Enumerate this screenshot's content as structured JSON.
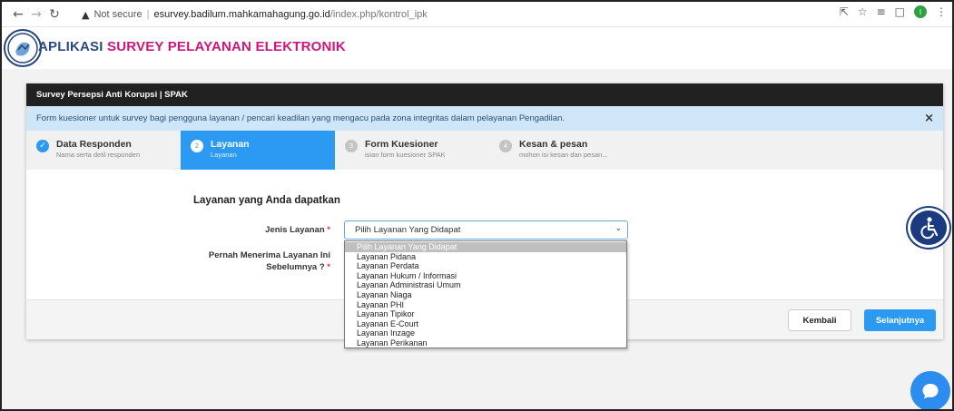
{
  "browser": {
    "security_label": "Not secure",
    "url_host": "esurvey.badilum.mahkamahagung.go.id",
    "url_path": "/index.php/kontrol_ipk",
    "profile_initial": "I"
  },
  "app": {
    "title_part1": "APLIKASI ",
    "title_part2": "SURVEY PELAYANAN ELEKTRONIK"
  },
  "card": {
    "header": "Survey Persepsi Anti Korupsi | SPAK",
    "alert": "Form kuesioner untuk survey bagi pengguna layanan / pencari keadilan yang mengacu pada zona integritas dalam pelayanan Pengadilan.",
    "alert_close": "×"
  },
  "steps": [
    {
      "number": "✓",
      "title": "Data Responden",
      "subtitle": "Nama serta detil responden",
      "state": "done"
    },
    {
      "number": "2",
      "title": "Layanan",
      "subtitle": "Layanan",
      "state": "current"
    },
    {
      "number": "3",
      "title": "Form Kuesioner",
      "subtitle": "isian form kuesioner SPAK",
      "state": "pending"
    },
    {
      "number": "4",
      "title": "Kesan & pesan",
      "subtitle": "mohon isi kesan dan pesan...",
      "state": "pending"
    }
  ],
  "form": {
    "section_title": "Layanan yang Anda dapatkan",
    "jenis_label": "Jenis Layanan",
    "pernah_label_line1": "Pernah Menerima Layanan Ini",
    "pernah_label_line2": "Sebelumnya ?",
    "required_mark": "*",
    "select_value": "Pilih Layanan Yang Didapat"
  },
  "dropdown_options": [
    "Pilih Layanan Yang Didapat",
    "Layanan Pidana",
    "Layanan Perdata",
    "Layanan Hukum / Informasi",
    "Layanan Administrasi Umum",
    "Layanan Niaga",
    "Layanan PHI",
    "Layanan Tipikor",
    "Layanan E-Court",
    "Layanan Inzage",
    "Layanan Perikanan"
  ],
  "buttons": {
    "back": "Kembali",
    "next": "Selanjutnya"
  },
  "colors": {
    "accent": "#2c9af2",
    "brand_blue": "#2b4a80",
    "brand_pink": "#d0147a",
    "header_dark": "#212121",
    "alert_bg": "#cfe6f8"
  }
}
